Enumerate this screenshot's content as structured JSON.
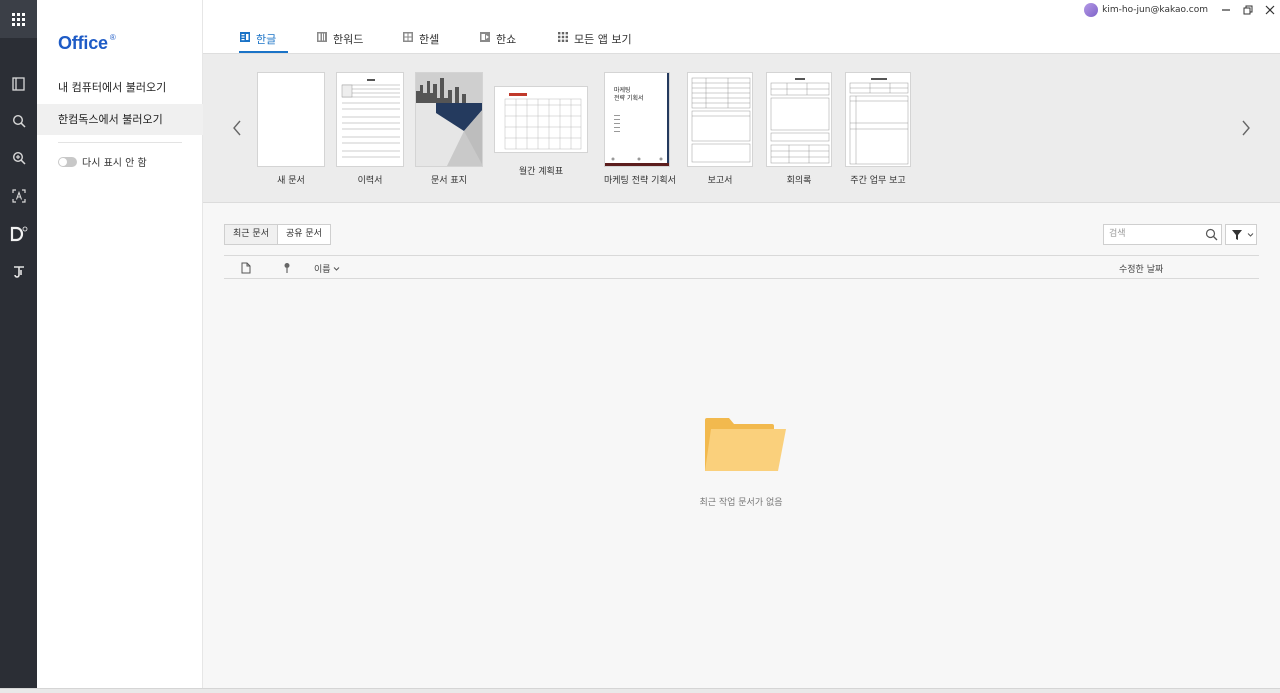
{
  "app": {
    "logo": "Office",
    "logo_mark": "®"
  },
  "user": {
    "email": "kim-ho-jun@kakao.com"
  },
  "tabs": [
    {
      "label": "한글",
      "active": true,
      "icon": "hangul-icon"
    },
    {
      "label": "한워드",
      "active": false,
      "icon": "hanword-icon"
    },
    {
      "label": "한셀",
      "active": false,
      "icon": "hancell-icon"
    },
    {
      "label": "한쇼",
      "active": false,
      "icon": "hanshow-icon"
    },
    {
      "label": "모든 앱 보기",
      "active": false,
      "icon": "all-apps-icon"
    }
  ],
  "sidebar": {
    "items": [
      {
        "label": "내 컴퓨터에서 불러오기",
        "active": false
      },
      {
        "label": "한컴독스에서 불러오기",
        "active": true
      }
    ],
    "toggle_label": "다시 표시 안 함"
  },
  "templates": [
    {
      "label": "새 문서"
    },
    {
      "label": "이력서"
    },
    {
      "label": "문서 표지"
    },
    {
      "label": "월간 계획표"
    },
    {
      "label": "마케팅 전략 기획서",
      "thumb_title": "마케팅\n전략 기획서"
    },
    {
      "label": "보고서"
    },
    {
      "label": "회의록"
    },
    {
      "label": "주간 업무 보고"
    }
  ],
  "documents": {
    "filter_tabs": [
      "최근 문서",
      "공유 문서"
    ],
    "search_placeholder": "검색",
    "columns": {
      "name": "이름",
      "modified": "수정한 날짜"
    },
    "empty_message": "최근 작업 문서가 없음"
  },
  "colors": {
    "accent": "#1a73c7",
    "logo": "#1e5bc6",
    "rail": "#2b2e35",
    "folder": "#f9c76a"
  }
}
